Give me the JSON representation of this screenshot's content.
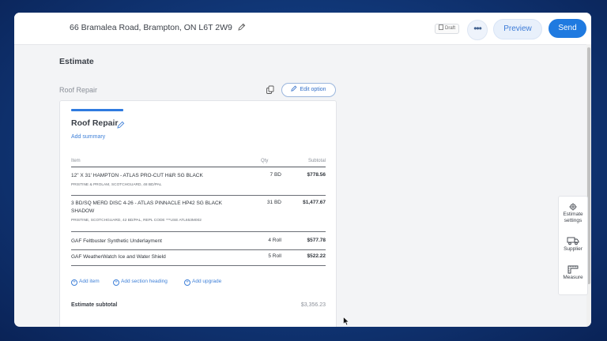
{
  "header": {
    "address": "66 Bramalea Road, Brampton, ON L6T 2W9",
    "draft_label": "Draft",
    "more_label": "•••",
    "preview_label": "Preview",
    "send_label": "Send"
  },
  "main": {
    "title": "Estimate",
    "option_name": "Roof Repair",
    "edit_option_label": "Edit option"
  },
  "card": {
    "title": "Roof Repair",
    "add_summary": "Add summary",
    "columns": {
      "item": "Item",
      "qty": "Qty",
      "subtotal": "Subtotal"
    },
    "rows": [
      {
        "name": "12\" X 31' HAMPTON - ATLAS PRO-CUT H&R SG BLACK",
        "desc": "PRISTINE & PROLAM, SCOTCHGUARD, 48 BD/PAL",
        "qty": "7 BD",
        "subtotal": "$778.56"
      },
      {
        "name": "3 BD/SQ MERD DISC 4-26 - ATLAS PINNACLE HP42 SG BLACK SHADOW",
        "desc": "PRISTINE, SCOTCHGUARD, 42 BD/PAL, REPL CODE ***USE ATL653M002",
        "qty": "31 BD",
        "subtotal": "$1,477.67"
      },
      {
        "name": "GAF Feltbuster Synthetic Underlayment",
        "desc": "",
        "qty": "4 Roll",
        "subtotal": "$577.78"
      },
      {
        "name": "GAF WeatherWatch Ice and Water Shield",
        "desc": "",
        "qty": "5 Roll",
        "subtotal": "$522.22"
      }
    ],
    "actions": {
      "add_item": "Add item",
      "add_section": "Add section heading",
      "add_upgrade": "Add upgrade"
    },
    "subtotal_label": "Estimate subtotal",
    "subtotal_value": "$3,356.23"
  },
  "side_panel": {
    "estimate_settings_1": "Estimate",
    "estimate_settings_2": "settings",
    "supplier": "Supplier",
    "measure": "Measure"
  },
  "colors": {
    "accent": "#1f7ae0",
    "link": "#3f80d8",
    "background": "#123b7e"
  },
  "icons": [
    "pencil-icon",
    "document-icon",
    "copy-icon",
    "gear-icon",
    "truck-icon",
    "ruler-icon",
    "cursor-icon"
  ]
}
